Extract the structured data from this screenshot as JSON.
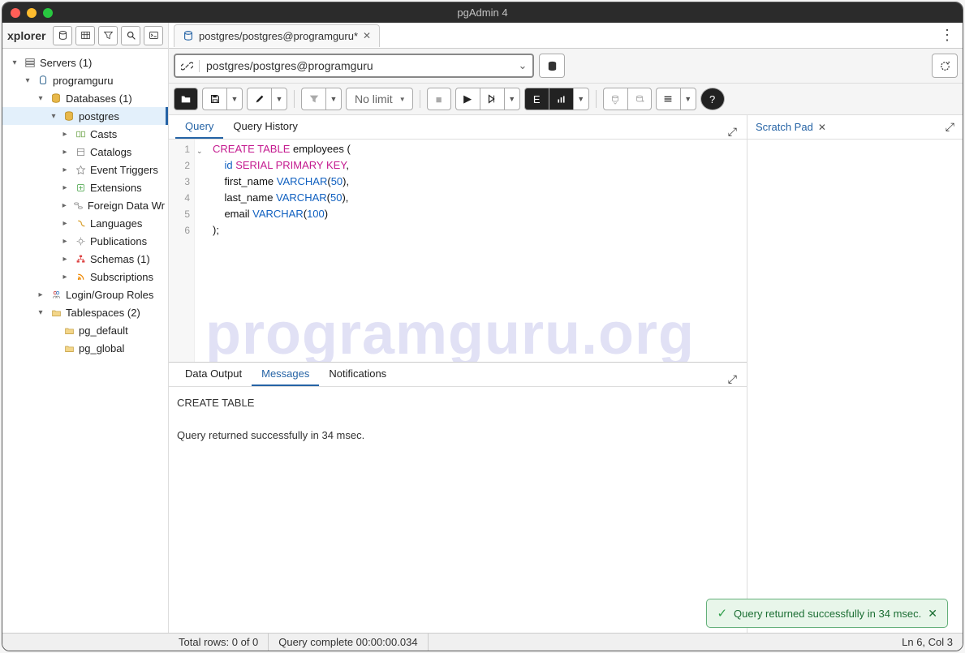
{
  "window": {
    "title": "pgAdmin 4"
  },
  "sidebar": {
    "title": "xplorer",
    "nodes": [
      {
        "lvl": 0,
        "chev": "▾",
        "icon": "servers",
        "label": "Servers (1)"
      },
      {
        "lvl": 1,
        "chev": "▾",
        "icon": "elephant",
        "label": "programguru"
      },
      {
        "lvl": 2,
        "chev": "▾",
        "icon": "db-grp",
        "label": "Databases (1)"
      },
      {
        "lvl": 3,
        "chev": "▾",
        "icon": "database",
        "label": "postgres",
        "selected": true
      },
      {
        "lvl": 4,
        "chev": "▸",
        "icon": "casts",
        "label": "Casts"
      },
      {
        "lvl": 4,
        "chev": "▸",
        "icon": "catalogs",
        "label": "Catalogs"
      },
      {
        "lvl": 4,
        "chev": "▸",
        "icon": "events",
        "label": "Event Triggers"
      },
      {
        "lvl": 4,
        "chev": "▸",
        "icon": "extensions",
        "label": "Extensions"
      },
      {
        "lvl": 4,
        "chev": "▸",
        "icon": "fdw",
        "label": "Foreign Data Wr"
      },
      {
        "lvl": 4,
        "chev": "▸",
        "icon": "languages",
        "label": "Languages"
      },
      {
        "lvl": 4,
        "chev": "▸",
        "icon": "publications",
        "label": "Publications"
      },
      {
        "lvl": 4,
        "chev": "▸",
        "icon": "schemas",
        "label": "Schemas (1)"
      },
      {
        "lvl": 4,
        "chev": "▸",
        "icon": "subscriptions",
        "label": "Subscriptions"
      },
      {
        "lvl": 2,
        "chev": "▸",
        "icon": "roles",
        "label": "Login/Group Roles"
      },
      {
        "lvl": 2,
        "chev": "▾",
        "icon": "tablespaces",
        "label": "Tablespaces (2)"
      },
      {
        "lvl": 3,
        "chev": "",
        "icon": "folder",
        "label": "pg_default"
      },
      {
        "lvl": 3,
        "chev": "",
        "icon": "folder",
        "label": "pg_global"
      }
    ]
  },
  "tab": {
    "label": "postgres/postgres@programguru*"
  },
  "connection": {
    "value": "postgres/postgres@programguru"
  },
  "toolbar": {
    "limit": "No limit"
  },
  "editor_tabs": {
    "query": "Query",
    "history": "Query History"
  },
  "scratch": {
    "title": "Scratch Pad"
  },
  "code": {
    "lines": [
      "<span class='k'>CREATE</span> <span class='k'>TABLE</span> employees (",
      "    <span class='t'>id</span> <span class='k'>SERIAL</span> <span class='k'>PRIMARY</span> <span class='k'>KEY</span>,",
      "    first_name <span class='t'>VARCHAR</span>(<span class='n'>50</span>),",
      "    last_name <span class='t'>VARCHAR</span>(<span class='n'>50</span>),",
      "    email <span class='t'>VARCHAR</span>(<span class='n'>100</span>)",
      ");"
    ]
  },
  "watermark": "programguru.org",
  "output_tabs": {
    "data": "Data Output",
    "messages": "Messages",
    "notifications": "Notifications"
  },
  "messages": {
    "line1": "CREATE TABLE",
    "line2": "Query returned successfully in 34 msec."
  },
  "status": {
    "rows": "Total rows: 0 of 0",
    "complete": "Query complete 00:00:00.034",
    "cursor": "Ln 6, Col 3"
  },
  "toast": {
    "text": "Query returned successfully in 34 msec."
  }
}
